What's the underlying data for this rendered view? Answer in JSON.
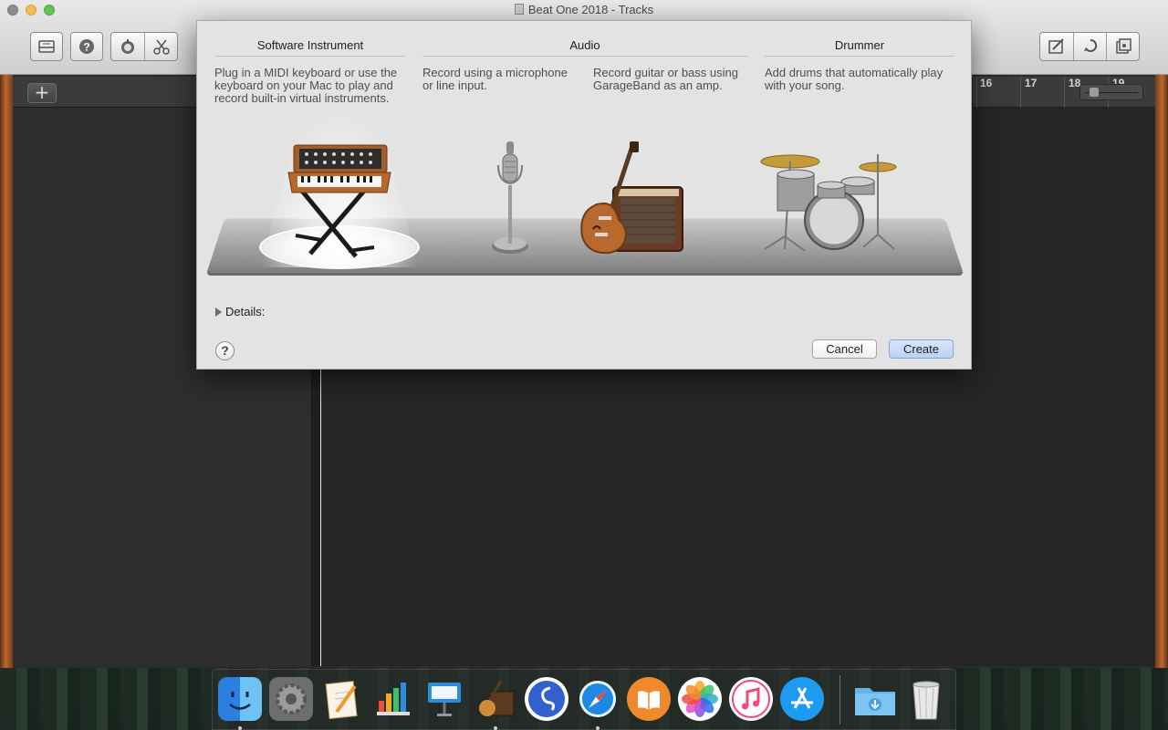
{
  "window": {
    "title": "Beat One 2018 - Tracks"
  },
  "toolbar": {
    "library_icon": "library-icon",
    "help_icon": "help-icon",
    "smart_controls_icon": "smart-controls-icon",
    "editors_icon": "scissors-icon",
    "notepad_icon": "notepad-icon",
    "loop_browser_icon": "loop-icon",
    "media_browser_icon": "media-icon"
  },
  "tracks": {
    "add_label": "+"
  },
  "ruler": {
    "bars": [
      "16",
      "17",
      "18",
      "19"
    ]
  },
  "dialog": {
    "columns": [
      {
        "heading": "Software Instrument",
        "descriptions": [
          "Plug in a MIDI keyboard or use the keyboard on your Mac to play and record built-in virtual instruments."
        ]
      },
      {
        "heading": "Audio",
        "descriptions": [
          "Record using a microphone or line input.",
          "Record guitar or bass using GarageBand as an amp."
        ]
      },
      {
        "heading": "Drummer",
        "descriptions": [
          "Add drums that automatically play with your song."
        ]
      }
    ],
    "details_label": "Details:",
    "help_label": "?",
    "cancel_label": "Cancel",
    "create_label": "Create"
  },
  "dock": {
    "apps": [
      "Finder",
      "System Preferences",
      "Pages",
      "Numbers",
      "Keynote",
      "GarageBand",
      "Simplenote",
      "Safari",
      "iBooks",
      "Photos",
      "iTunes",
      "App Store",
      "Downloads",
      "Trash"
    ],
    "colors": {
      "finder": "#3a8ee6",
      "safari": "#1e88e5",
      "ibooks": "#f0892c",
      "itunes": "#f14a7a",
      "appstore": "#1d9bf0"
    }
  }
}
